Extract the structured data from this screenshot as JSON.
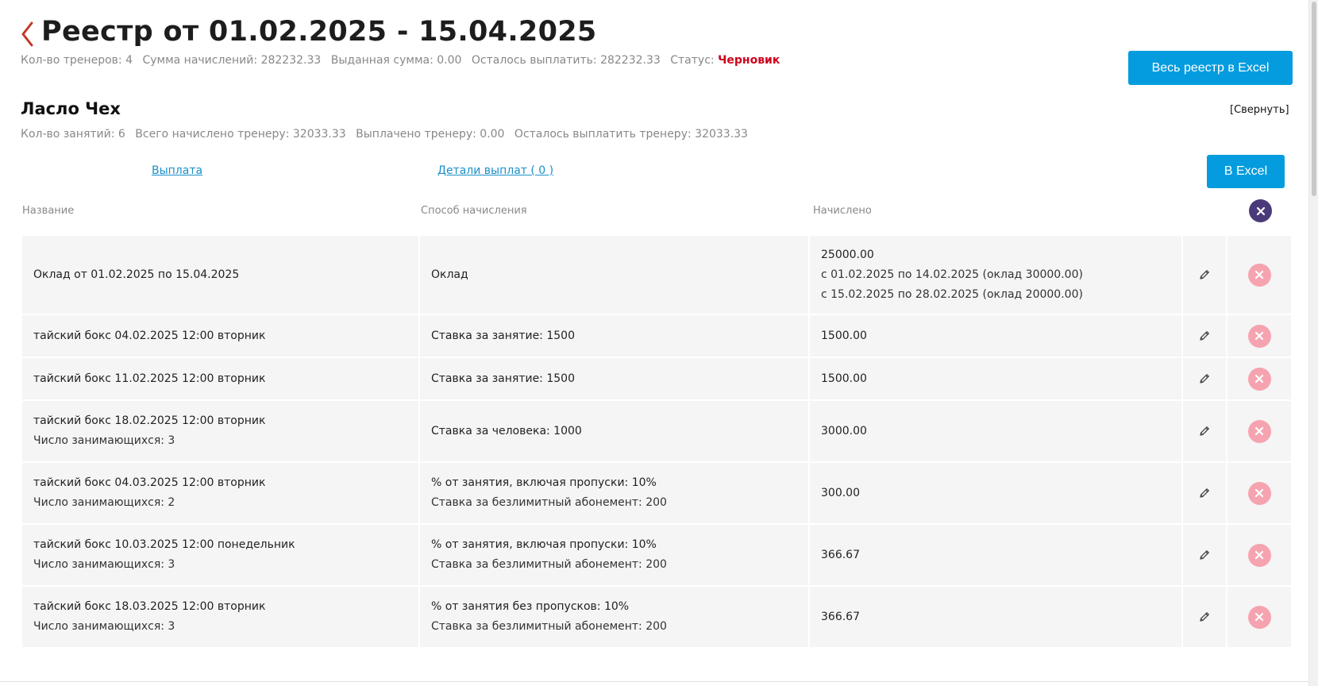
{
  "header": {
    "title": "Реестр от 01.02.2025 - 15.04.2025",
    "summary": [
      {
        "label": "Кол-во тренеров:",
        "value": "4"
      },
      {
        "label": "Сумма начислений:",
        "value": "282232.33"
      },
      {
        "label": "Выданная сумма:",
        "value": "0.00"
      },
      {
        "label": "Осталось выплатить:",
        "value": "282232.33"
      }
    ],
    "status_label": "Статус:",
    "status_value": "Черновик",
    "status_color": "#d0021b",
    "full_excel_button": "Весь реестр в Excel"
  },
  "trainer": {
    "name": "Ласло Чех",
    "collapse": "[Свернуть]",
    "summary": [
      {
        "label": "Кол-во занятий:",
        "value": "6"
      },
      {
        "label": "Всего начислено тренеру:",
        "value": "32033.33"
      },
      {
        "label": "Выплачено тренеру:",
        "value": "0.00"
      },
      {
        "label": "Осталось выплатить тренеру:",
        "value": "32033.33"
      }
    ],
    "payout_link": "Выплата",
    "details_link": "Детали выплат ( 0 )",
    "excel_button": "В Excel"
  },
  "table": {
    "headers": [
      "Название",
      "Способ начисления",
      "Начислено"
    ],
    "rows": [
      {
        "name": [
          "Оклад от 01.02.2025 по 15.04.2025"
        ],
        "method": [
          "Оклад"
        ],
        "accrued": [
          "25000.00",
          "с 01.02.2025 по 14.02.2025 (оклад 30000.00)",
          "с 15.02.2025 по 28.02.2025 (оклад 20000.00)"
        ],
        "height": 98
      },
      {
        "name": [
          "тайский бокс 04.02.2025 12:00 вторник"
        ],
        "method": [
          "Ставка за занятие: 1500"
        ],
        "accrued": [
          "1500.00"
        ]
      },
      {
        "name": [
          "тайский бокс 11.02.2025 12:00 вторник"
        ],
        "method": [
          "Ставка за занятие: 1500"
        ],
        "accrued": [
          "1500.00"
        ]
      },
      {
        "name": [
          "тайский бокс 18.02.2025 12:00 вторник",
          "Число занимающихся: 3"
        ],
        "method": [
          "Ставка за человека: 1000"
        ],
        "accrued": [
          "3000.00"
        ]
      },
      {
        "name": [
          "тайский бокс 04.03.2025 12:00 вторник",
          "Число занимающихся: 2"
        ],
        "method": [
          "% от занятия, включая пропуски: 10%",
          "Ставка за безлимитный абонемент: 200"
        ],
        "accrued": [
          "300.00"
        ]
      },
      {
        "name": [
          "тайский бокс 10.03.2025 12:00 понедельник",
          "Число занимающихся: 3"
        ],
        "method": [
          "% от занятия, включая пропуски: 10%",
          "Ставка за безлимитный абонемент: 200"
        ],
        "accrued": [
          "366.67"
        ]
      },
      {
        "name": [
          "тайский бокс 18.03.2025 12:00 вторник",
          "Число занимающихся: 3"
        ],
        "method": [
          "% от занятия без пропусков: 10%",
          "Ставка за безлимитный абонемент: 200"
        ],
        "accrued": [
          "366.67"
        ]
      }
    ]
  },
  "colors": {
    "accent": "#049cde",
    "link": "#1a8fc9",
    "delete": "#f6a3b0",
    "close_all": "#4a3a7a",
    "back_arrow": "#c0392b"
  },
  "icons": {
    "back": "chevron-left-icon",
    "edit": "pencil-icon",
    "delete": "close-icon"
  }
}
